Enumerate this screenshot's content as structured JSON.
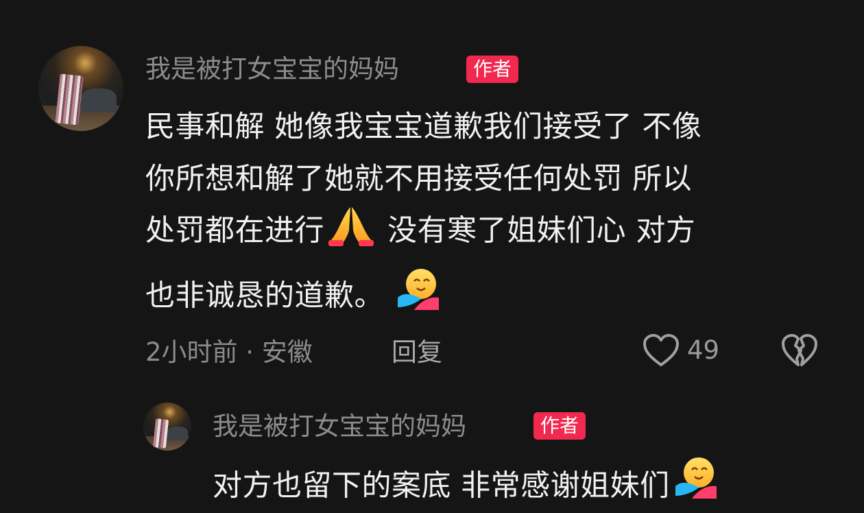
{
  "comment": {
    "username": "我是被打女宝宝的妈妈",
    "author_badge": "作者",
    "lines": [
      "民事和解 她像我宝宝道歉我们接受了  不像",
      "你所想和解了她就不用接受任何处罚 所以",
      "处罚都在进行",
      " 没有寒了姐妹们心 对方",
      "也非诚恳的道歉。"
    ],
    "emojis": [
      "folded-hands-icon",
      "hugging-face-icon"
    ],
    "meta": "2小时前 · 安徽",
    "reply_label": "回复",
    "like_count": "49"
  },
  "reply": {
    "username": "我是被打女宝宝的妈妈",
    "author_badge": "作者",
    "text": "对方也留下的案底 非常感谢姐妹们",
    "emoji": "hugging-face-icon"
  },
  "colors": {
    "background": "#151515",
    "badge": "#f2294f",
    "username": "#8c8c8c",
    "text": "#f1f1f1"
  }
}
